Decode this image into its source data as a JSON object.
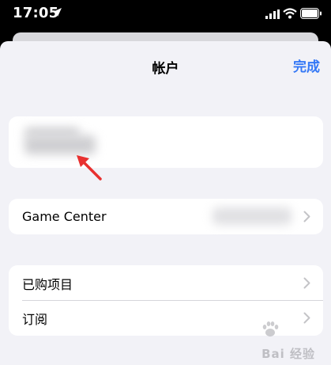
{
  "status_bar": {
    "time": "17:05"
  },
  "nav": {
    "title": "帐户",
    "done_label": "完成"
  },
  "rows": {
    "game_center": "Game Center",
    "purchases": "已购项目",
    "subscriptions": "订阅"
  },
  "watermark": {
    "text": "Bai 经验"
  },
  "colors": {
    "accent": "#3478f6",
    "background": "#f2f2f7",
    "arrow": "#e8302f"
  }
}
